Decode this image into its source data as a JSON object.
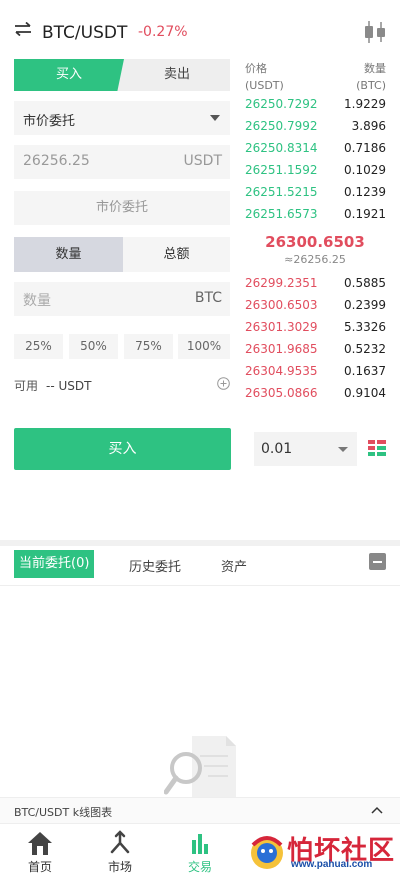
{
  "header": {
    "pair": "BTC/USDT",
    "change": "-0.27%"
  },
  "trade_tabs": {
    "buy": "买入",
    "sell": "卖出"
  },
  "order_type": {
    "selected": "市价委托"
  },
  "price_input": {
    "value": "26256.25",
    "unit": "USDT"
  },
  "market_label": "市价委托",
  "amount_tabs": {
    "quantity": "数量",
    "total": "总额"
  },
  "quantity_input": {
    "placeholder": "数量",
    "unit": "BTC"
  },
  "percent_buttons": [
    "25%",
    "50%",
    "75%",
    "100%"
  ],
  "available": {
    "label": "可用",
    "value": "-- USDT"
  },
  "buy_button": "买入",
  "depth": {
    "value": "0.01"
  },
  "orderbook": {
    "price_header": "价格",
    "price_unit": "(USDT)",
    "qty_header": "数量",
    "qty_unit": "(BTC)",
    "top_rows": [
      {
        "price": "26250.7292",
        "qty": "1.9229"
      },
      {
        "price": "26250.7992",
        "qty": "3.896"
      },
      {
        "price": "26250.8314",
        "qty": "0.7186"
      },
      {
        "price": "26251.1592",
        "qty": "0.1029"
      },
      {
        "price": "26251.5215",
        "qty": "0.1239"
      },
      {
        "price": "26251.6573",
        "qty": "0.1921"
      }
    ],
    "last_price": "26300.6503",
    "index_price": "≈26256.25",
    "bottom_rows": [
      {
        "price": "26299.2351",
        "qty": "0.5885"
      },
      {
        "price": "26300.6503",
        "qty": "0.2399"
      },
      {
        "price": "26301.3029",
        "qty": "5.3326"
      },
      {
        "price": "26301.9685",
        "qty": "0.5232"
      },
      {
        "price": "26304.9535",
        "qty": "0.1637"
      },
      {
        "price": "26305.0866",
        "qty": "0.9104"
      }
    ]
  },
  "order_tabs": {
    "current": "当前委托(0)",
    "history": "历史委托",
    "assets": "资产"
  },
  "kline_bar": {
    "label": "BTC/USDT k线图表"
  },
  "nav": {
    "home": "首页",
    "market": "市场",
    "trade": "交易"
  },
  "watermark": {
    "text": "怕坏社区",
    "url": "www.pahuai.com"
  },
  "colors": {
    "green": "#2ec282",
    "red": "#e14d5e"
  }
}
